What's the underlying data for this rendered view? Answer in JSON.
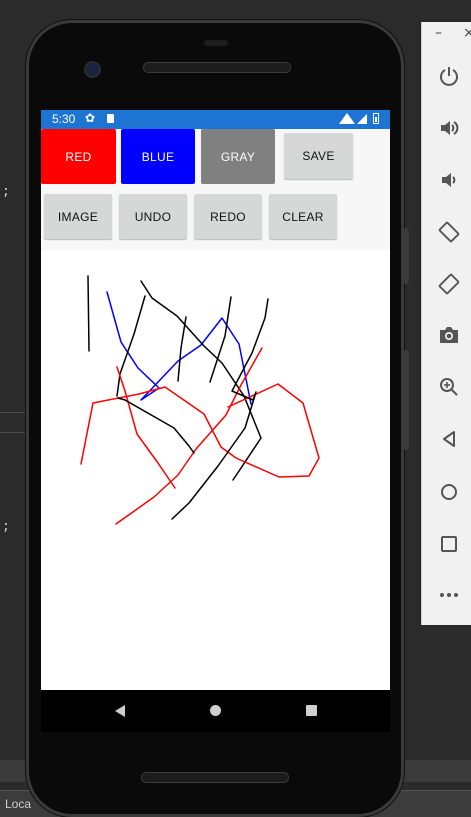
{
  "ide": {
    "code_fragments": [
      ";",
      ";"
    ],
    "status_text": "Loca"
  },
  "device": {
    "status_bar": {
      "time": "5:30",
      "icons": [
        "gear-icon",
        "sd-card-icon",
        "wifi-icon",
        "signal-icon",
        "battery-icon"
      ]
    },
    "buttons": {
      "red": {
        "label": "RED",
        "color": "#ff0000"
      },
      "blue": {
        "label": "BLUE",
        "color": "#0000ff"
      },
      "gray": {
        "label": "GRAY",
        "color": "#808080"
      },
      "save": {
        "label": "SAVE"
      },
      "image": {
        "label": "IMAGE"
      },
      "undo": {
        "label": "UNDO"
      },
      "redo": {
        "label": "REDO"
      },
      "clear": {
        "label": "CLEAR"
      }
    },
    "nav": [
      "back-icon",
      "home-icon",
      "recents-icon"
    ]
  },
  "drawing": {
    "strokes": [
      {
        "color": "#000000"
      },
      {
        "color": "#0000ff"
      },
      {
        "color": "#000000"
      },
      {
        "color": "#000000"
      },
      {
        "color": "#000000"
      },
      {
        "color": "#000000"
      },
      {
        "color": "#ff0000"
      },
      {
        "color": "#ff0000"
      },
      {
        "color": "#ff0000"
      },
      {
        "color": "#000000"
      }
    ]
  },
  "emulator_controls": {
    "window": {
      "minimize": "–",
      "close": "×"
    },
    "items": [
      "power-icon",
      "volume-up-icon",
      "volume-down-icon",
      "rotate-left-icon",
      "rotate-right-icon",
      "camera-icon",
      "zoom-icon",
      "back-icon",
      "home-icon",
      "overview-icon",
      "more-icon"
    ]
  }
}
